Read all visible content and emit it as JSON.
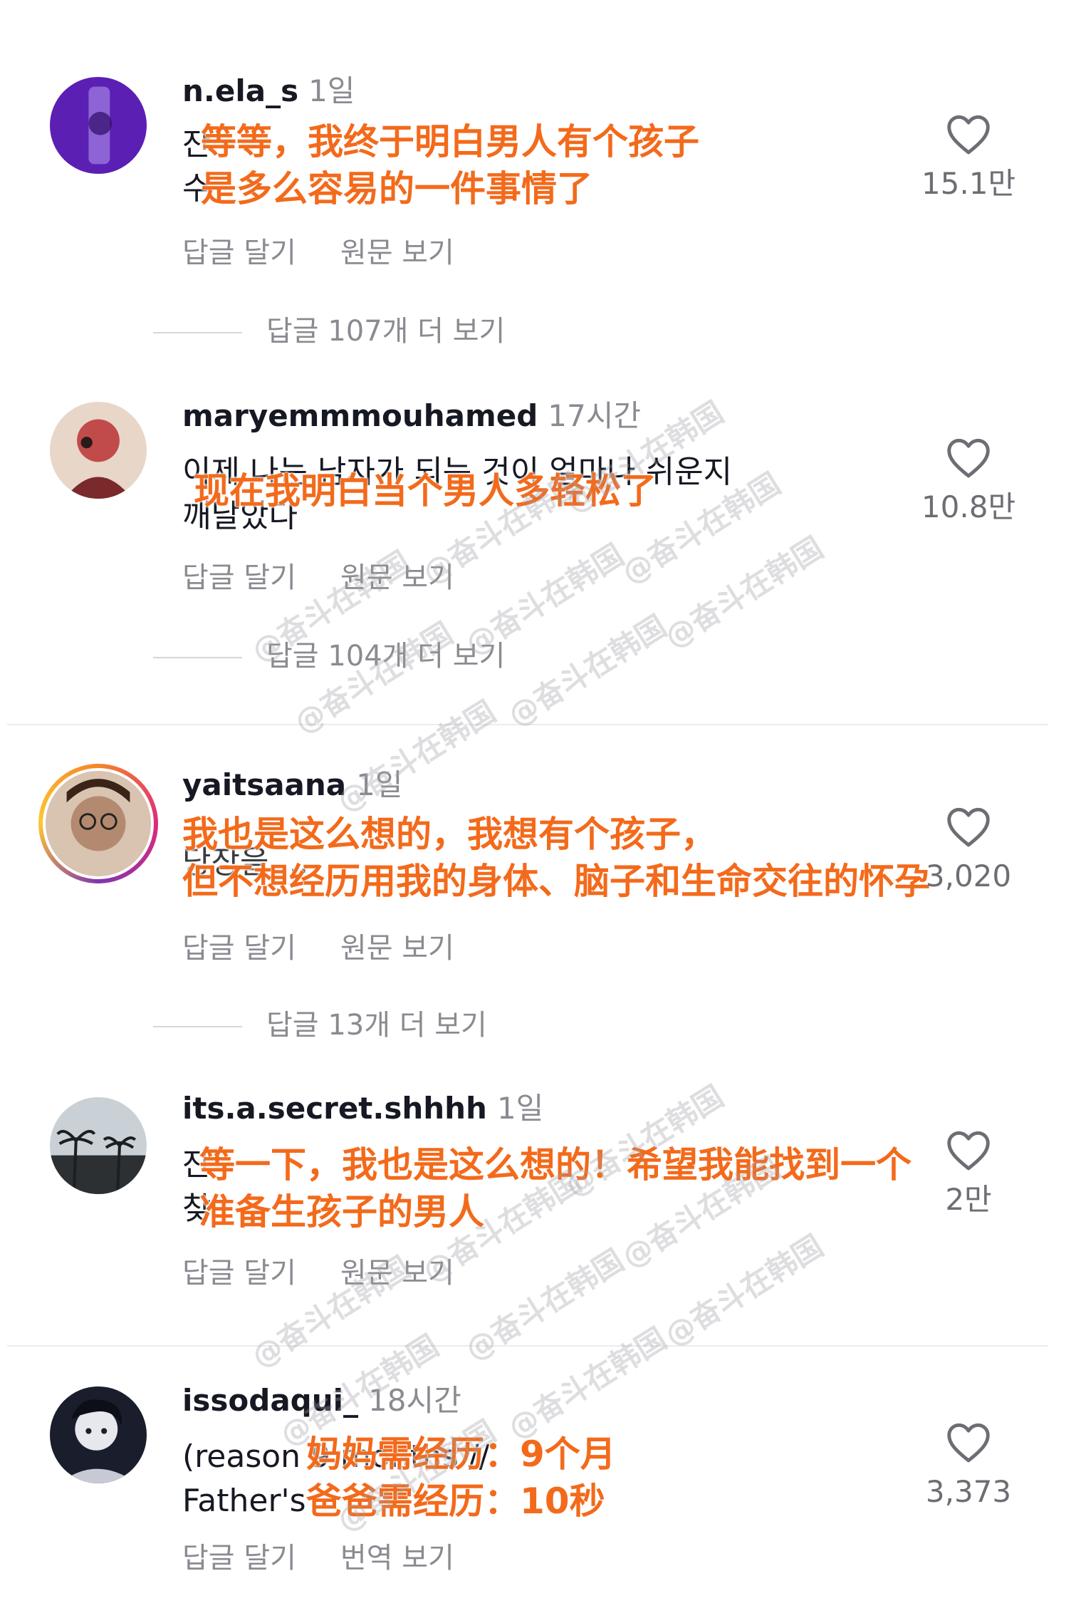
{
  "comments": [
    {
      "username": "n.ela_s",
      "time": "1일",
      "body_lines": [
        "잔",
        "수"
      ],
      "overlay_lines": [
        "等等，我终于明白男人有个孩子",
        "是多么容易的一件事情了"
      ],
      "actions": [
        "답글 달기",
        "원문 보기"
      ],
      "likes": "15.1만",
      "more_replies": "답글 107개 더 보기"
    },
    {
      "username": "maryemmmouhamed",
      "time": "17시간",
      "body_lines": [
        "이제 나는 남자가 되는 것이 얼마나 쉬운지",
        "깨날았다"
      ],
      "overlay_lines": [
        "现在我明白当个男人多轻松了"
      ],
      "actions": [
        "답글 달기",
        "원문 보기"
      ],
      "likes": "10.8만",
      "more_replies": "답글 104개 더 보기"
    },
    {
      "username": "yaitsaana",
      "time": "1일",
      "body_lines": [
        "",
        "당장을 ..."
      ],
      "overlay_lines": [
        "我也是这么想的，我想有个孩子，",
        "但不想经历用我的身体、脑子和生命交往的怀孕"
      ],
      "actions": [
        "답글 달기",
        "원문 보기"
      ],
      "likes": "3,020",
      "more_replies": "답글 13개 더 보기"
    },
    {
      "username": "its.a.secret.shhhh",
      "time": "1일",
      "body_lines": [
        "잔",
        "찾"
      ],
      "overlay_lines": [
        "等一下，我也是这么想的！希望我能找到一个",
        "准备生孩子的男人"
      ],
      "actions": [
        "답글 달기",
        "원문 보기"
      ],
      "likes": "2만",
      "more_replies": ""
    },
    {
      "username": "issodaqui_",
      "time": "18시간",
      "body_lines": [
        "(reason                          9 months //",
        "Father's"
      ],
      "overlay_lines": [
        "妈妈需经历：9个月",
        "爸爸需经历：10秒"
      ],
      "actions": [
        "답글 달기",
        "번역 보기"
      ],
      "likes": "3,373",
      "more_replies": ""
    }
  ],
  "watermark": "@奋斗在韩国",
  "icons": {
    "like": "heart-outline-icon"
  },
  "colors": {
    "overlay": "#f36a1b",
    "muted": "#8a8b91",
    "text": "#161823"
  }
}
